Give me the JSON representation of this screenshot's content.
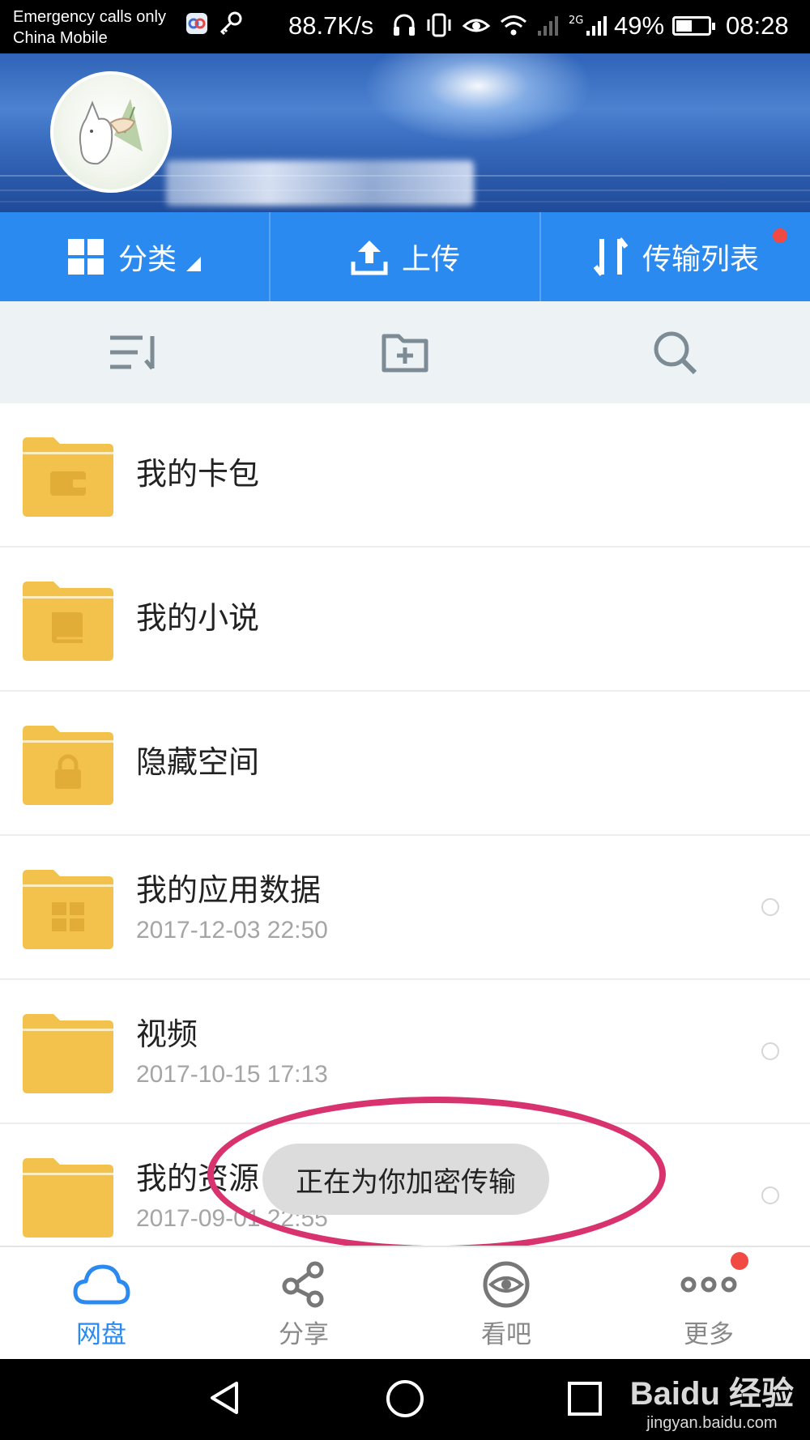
{
  "status_bar": {
    "line1": "Emergency calls only",
    "line2": "China Mobile",
    "speed": "88.7K/s",
    "network_tag": "2G",
    "battery_pct": "49%",
    "battery_level": 0.49,
    "time": "08:28"
  },
  "header": {
    "avatar_icon": "cat-avatar",
    "username_blurred": ""
  },
  "tabs": {
    "category": "分类",
    "upload": "上传",
    "transfer": "传输列表"
  },
  "toolbar": {
    "sort_icon": "sort-icon",
    "new_folder_icon": "new-folder-icon",
    "search_icon": "search-icon"
  },
  "files": [
    {
      "name": "我的卡包",
      "date": "",
      "icon": "wallet-icon"
    },
    {
      "name": "我的小说",
      "date": "",
      "icon": "book-icon"
    },
    {
      "name": "隐藏空间",
      "date": "",
      "icon": "lock-icon"
    },
    {
      "name": "我的应用数据",
      "date": "2017-12-03  22:50",
      "icon": "apps-icon"
    },
    {
      "name": "视频",
      "date": "2017-10-15  17:13",
      "icon": ""
    },
    {
      "name": "我的资源",
      "date": "2017-09-01  22:55",
      "icon": ""
    }
  ],
  "toast": "正在为你加密传输",
  "bottom_nav": {
    "netdisk": "网盘",
    "share": "分享",
    "watch": "看吧",
    "more": "更多"
  },
  "colors": {
    "accent": "#2b8af0",
    "folder": "#f3c24d",
    "badge": "#f04a42",
    "highlight_ellipse": "#d8336e"
  },
  "watermark": {
    "main": "Baidu 经验",
    "sub": "jingyan.baidu.com"
  }
}
